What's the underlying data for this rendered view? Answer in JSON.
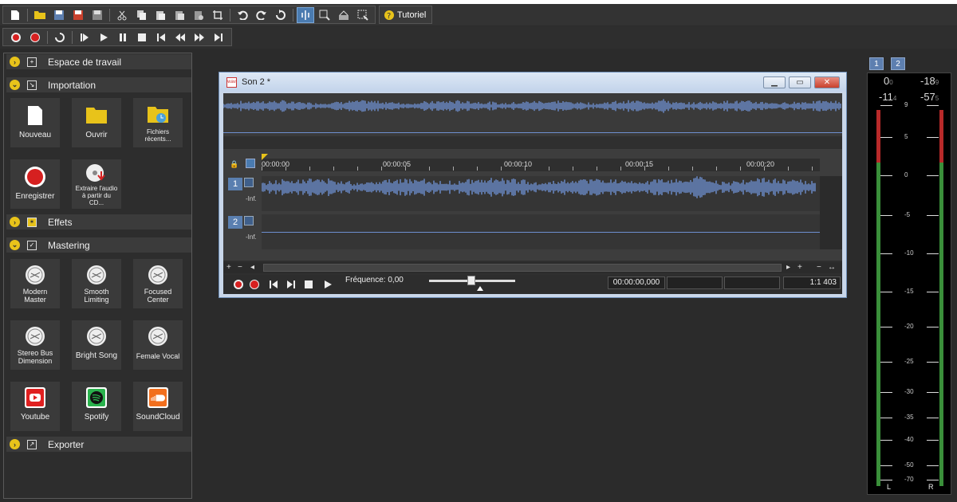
{
  "toolbar": {
    "tutorial_label": "Tutoriel"
  },
  "sidebar": {
    "sections": [
      {
        "title": "Espace de travail"
      },
      {
        "title": "Importation"
      },
      {
        "title": "Effets"
      },
      {
        "title": "Mastering"
      },
      {
        "title": "Exporter"
      }
    ],
    "import_tiles": [
      {
        "label": "Nouveau"
      },
      {
        "label": "Ouvrir"
      },
      {
        "label": "Fichiers récents..."
      },
      {
        "label": "Enregistrer"
      },
      {
        "label": "Extraire l'audio à partir du CD..."
      }
    ],
    "mastering_tiles": [
      {
        "label": "Modern Master"
      },
      {
        "label": "Smooth Limiting"
      },
      {
        "label": "Focused Center"
      },
      {
        "label": "Stereo Bus Dimension"
      },
      {
        "label": "Bright Song"
      },
      {
        "label": "Female Vocal"
      },
      {
        "label": "Youtube"
      },
      {
        "label": "Spotify"
      },
      {
        "label": "SoundCloud"
      }
    ]
  },
  "document": {
    "title": "Son 2 *",
    "ruler_labels": [
      "00:00:00",
      "00:00:05",
      "00:00:10",
      "00:00:15",
      "00:00:20"
    ],
    "tracks": [
      {
        "number": "1",
        "level": "-Inf."
      },
      {
        "number": "2",
        "level": "-Inf."
      }
    ],
    "frequency_label": "Fréquence: 0,00",
    "time_value": "00:00:00,000",
    "zoom_ratio": "1:1 403"
  },
  "meter": {
    "tabs": [
      "1",
      "2"
    ],
    "peaks": {
      "left_peak": "0",
      "left_peak_dec": "0",
      "right_peak": "-18",
      "right_peak_dec": "9",
      "left_rms": "-11",
      "left_rms_dec": "4",
      "right_rms": "-57",
      "right_rms_dec": "5"
    },
    "scale": [
      "9",
      "5",
      "0",
      "-5",
      "-10",
      "-15",
      "-20",
      "-25",
      "-30",
      "-35",
      "-40",
      "-50",
      "-70"
    ],
    "channel_left": "L",
    "channel_right": "R"
  },
  "colors": {
    "accent": "#e8c31a",
    "waveform": "#6e8fd0",
    "meter_green": "#3a8f3a",
    "meter_red": "#b82a2a"
  }
}
